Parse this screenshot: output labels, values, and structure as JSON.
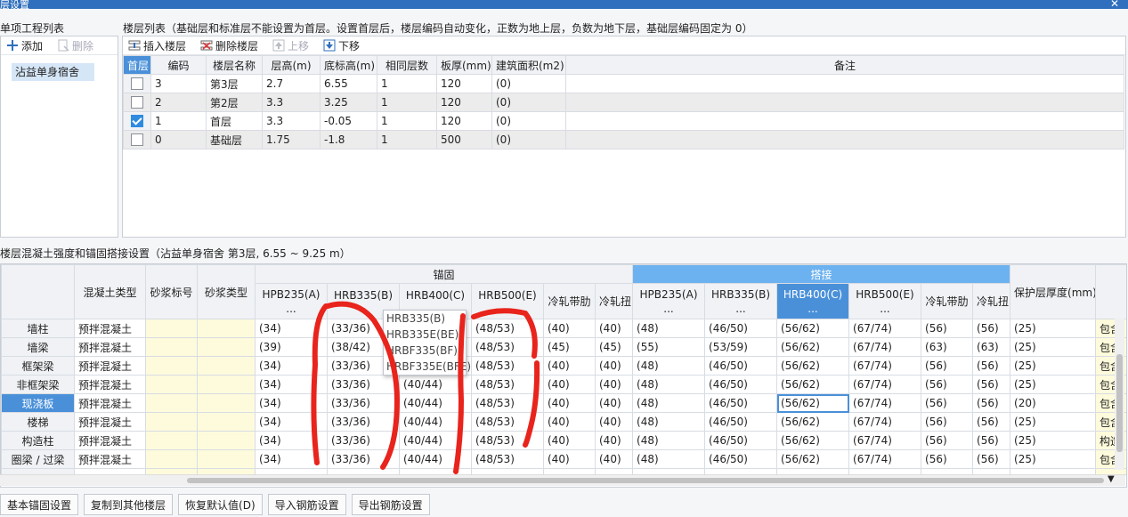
{
  "window": {
    "title": "层设置",
    "close_glyph": "✕"
  },
  "left_panel": {
    "caption": "单项工程列表",
    "add_label": "添加",
    "delete_label": "删除",
    "project_name": "沾益单身宿舍"
  },
  "floor_panel": {
    "caption": "楼层列表（基础层和标准层不能设置为首层。设置首层后，楼层编码自动变化，正数为地上层，负数为地下层，基础层编码固定为 0）",
    "insert_label": "插入楼层",
    "delete_label": "删除楼层",
    "up_label": "上移",
    "down_label": "下移",
    "columns": [
      "首层",
      "编码",
      "楼层名称",
      "层高(m)",
      "底标高(m)",
      "相同层数",
      "板厚(mm)",
      "建筑面积(m2)",
      "备注"
    ],
    "rows": [
      {
        "first": false,
        "code": "3",
        "name": "第3层",
        "height": "2.7",
        "base": "6.55",
        "same": "1",
        "slab": "120",
        "area": "(0)",
        "note": ""
      },
      {
        "first": false,
        "code": "2",
        "name": "第2层",
        "height": "3.3",
        "base": "3.25",
        "same": "1",
        "slab": "120",
        "area": "(0)",
        "note": ""
      },
      {
        "first": true,
        "code": "1",
        "name": "首层",
        "height": "3.3",
        "base": "-0.05",
        "same": "1",
        "slab": "120",
        "area": "(0)",
        "note": ""
      },
      {
        "first": false,
        "code": "0",
        "name": "基础层",
        "height": "1.75",
        "base": "-1.8",
        "same": "1",
        "slab": "500",
        "area": "(0)",
        "note": ""
      }
    ]
  },
  "grid_panel": {
    "caption": "楼层混凝土强度和锚固搭接设置（沾益单身宿舍  第3层, 6.55 ~ 9.25 m）",
    "group_anchor": "锚固",
    "group_lap": "搭接",
    "headers": {
      "concrete_type": "混凝土类型",
      "mortar_grade": "砂浆标号",
      "mortar_type": "砂浆类型",
      "anchor": [
        "HPB235(A)\n...",
        "HRB335(B)",
        "HRB400(C)",
        "HRB500(E)",
        "冷轧带肋",
        "冷轧扭"
      ],
      "lap": [
        "HPB235(A)\n...",
        "HRB335(B)\n...",
        "HRB400(C)\n...",
        "HRB500(E)\n...",
        "冷轧带肋",
        "冷轧扭"
      ],
      "cover": "保护层厚度(mm)"
    },
    "rows": [
      {
        "name": "墙柱",
        "ctype": "预拌混凝土",
        "a": [
          "(34)",
          "(33/36)",
          "",
          "(48/53)",
          "(40)",
          "(40)"
        ],
        "l": [
          "(48)",
          "(46/50)",
          "(56/62)",
          "(67/74)",
          "(56)",
          "(56)"
        ],
        "cover": "(25)",
        "rem": "包含"
      },
      {
        "name": "墙梁",
        "ctype": "预拌混凝土",
        "a": [
          "(39)",
          "(38/42)",
          "",
          "(48/53)",
          "(45)",
          "(45)"
        ],
        "l": [
          "(55)",
          "(53/59)",
          "(56/62)",
          "(67/74)",
          "(63)",
          "(63)"
        ],
        "cover": "(25)",
        "rem": "包含"
      },
      {
        "name": "框架梁",
        "ctype": "预拌混凝土",
        "a": [
          "(34)",
          "(33/36)",
          "",
          "(48/53)",
          "(40)",
          "(40)"
        ],
        "l": [
          "(48)",
          "(46/50)",
          "(56/62)",
          "(67/74)",
          "(56)",
          "(56)"
        ],
        "cover": "(25)",
        "rem": "包含"
      },
      {
        "name": "非框架梁",
        "ctype": "预拌混凝土",
        "a": [
          "(34)",
          "(33/36)",
          "(40/44)",
          "(48/53)",
          "(40)",
          "(40)"
        ],
        "l": [
          "(48)",
          "(46/50)",
          "(56/62)",
          "(67/74)",
          "(56)",
          "(56)"
        ],
        "cover": "(25)",
        "rem": "包含"
      },
      {
        "name": "现浇板",
        "ctype": "预拌混凝土",
        "a": [
          "(34)",
          "(33/36)",
          "(40/44)",
          "(48/53)",
          "(40)",
          "(40)"
        ],
        "l": [
          "(48)",
          "(46/50)",
          "(56/62)",
          "(67/74)",
          "(56)",
          "(56)"
        ],
        "cover": "(20)",
        "rem": "包含"
      },
      {
        "name": "楼梯",
        "ctype": "预拌混凝土",
        "a": [
          "(34)",
          "(33/36)",
          "(40/44)",
          "(48/53)",
          "(40)",
          "(40)"
        ],
        "l": [
          "(48)",
          "(46/50)",
          "(56/62)",
          "(67/74)",
          "(56)",
          "(56)"
        ],
        "cover": "(25)",
        "rem": "包含"
      },
      {
        "name": "构造柱",
        "ctype": "预拌混凝土",
        "a": [
          "(34)",
          "(33/36)",
          "(40/44)",
          "(48/53)",
          "(40)",
          "(40)"
        ],
        "l": [
          "(48)",
          "(46/50)",
          "(56/62)",
          "(67/74)",
          "(56)",
          "(56)"
        ],
        "cover": "(25)",
        "rem": "构造"
      },
      {
        "name": "圈梁 / 过梁",
        "ctype": "预拌混凝土",
        "a": [
          "(34)",
          "(33/36)",
          "(40/44)",
          "(48/53)",
          "(40)",
          "(40)"
        ],
        "l": [
          "(48)",
          "(46/50)",
          "(56/62)",
          "(67/74)",
          "(56)",
          "(56)"
        ],
        "cover": "(25)",
        "rem": "包含"
      }
    ],
    "dropdown_options": [
      "HRB335(B)",
      "HRB335E(BE)",
      "HRBF335(BF)",
      "HRBF335E(BFE)"
    ]
  },
  "bottom_buttons": [
    "基本锚固设置",
    "复制到其他楼层",
    "恢复默认值(D)",
    "导入钢筋设置",
    "导出钢筋设置"
  ],
  "colors": {
    "accent": "#4a90d9",
    "title_bar": "#2f6fbd",
    "annotation": "#e8241c",
    "mortar_cell": "#fdfbdc"
  }
}
